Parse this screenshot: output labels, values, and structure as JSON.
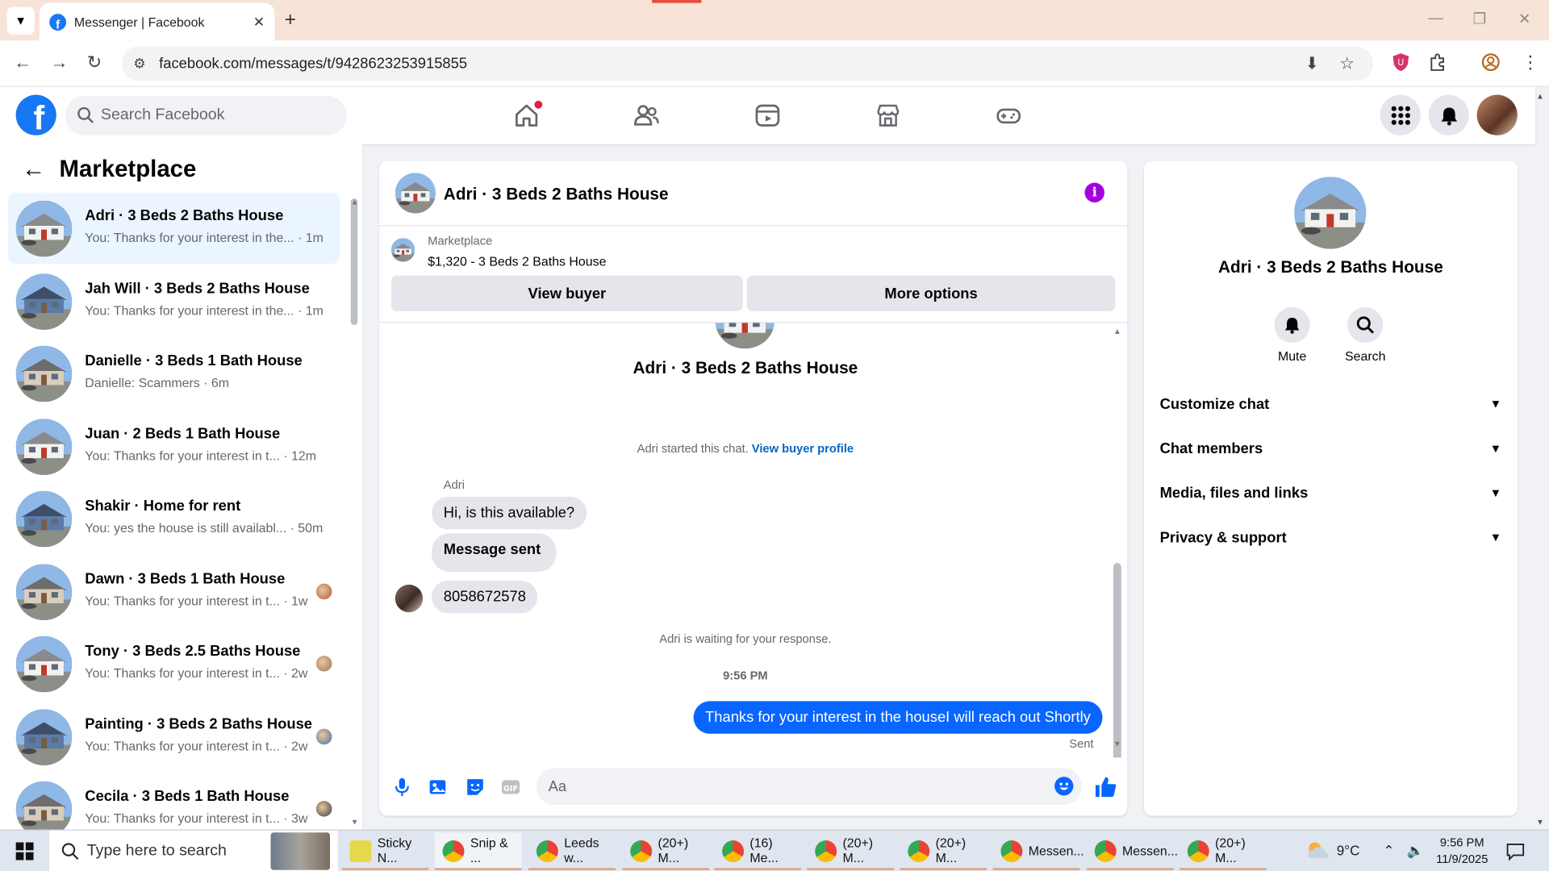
{
  "browser": {
    "tab_title": "Messenger | Facebook",
    "url": "facebook.com/messages/t/9428623253915855"
  },
  "header": {
    "search_placeholder": "Search Facebook"
  },
  "left": {
    "title": "Marketplace",
    "conversations": [
      {
        "title": "Adri · 3 Beds 2 Baths House",
        "preview": "You: Thanks for your interest in the...",
        "time": "1m",
        "active": true
      },
      {
        "title": "Jah Will · 3 Beds 2 Baths House",
        "preview": "You: Thanks for your interest in the...",
        "time": "1m"
      },
      {
        "title": "Danielle · 3 Beds 1 Bath House",
        "preview": "Danielle: Scammers",
        "time": "6m"
      },
      {
        "title": "Juan · 2 Beds 1 Bath House",
        "preview": "You: Thanks for your interest in t...",
        "time": "12m"
      },
      {
        "title": "Shakir · Home for rent",
        "preview": "You: yes the house is still availabl...",
        "time": "50m"
      },
      {
        "title": "Dawn · 3 Beds 1 Bath House",
        "preview": "You: Thanks for your interest in t...",
        "time": "1w"
      },
      {
        "title": "Tony · 3 Beds 2.5 Baths House",
        "preview": "You: Thanks for your interest in t...",
        "time": "2w"
      },
      {
        "title": "Painting · 3 Beds 2 Baths House",
        "preview": "You: Thanks for your interest in t...",
        "time": "2w"
      },
      {
        "title": "Cecila · 3 Beds 1 Bath House",
        "preview": "You: Thanks for your interest in t...",
        "time": "3w"
      }
    ]
  },
  "chat": {
    "title": "Adri · 3 Beds 2 Baths House",
    "marketplace_label": "Marketplace",
    "listing": "$1,320 - 3 Beds 2 Baths House",
    "view_buyer": "View buyer",
    "more_options": "More options",
    "center_title": "Adri · 3 Beds 2 Baths House",
    "started_text": "Adri started this chat.",
    "view_profile": "View buyer profile",
    "sender": "Adri",
    "incoming": [
      "Hi, is this available?",
      "Message sent",
      "8058672578"
    ],
    "waiting": "Adri is waiting for your response.",
    "time": "9:56 PM",
    "outgoing": "Thanks for your interest in the houseI will reach out Shortly",
    "sent_label": "Sent",
    "composer_placeholder": "Aa"
  },
  "right": {
    "title": "Adri · 3 Beds 2 Baths House",
    "mute": "Mute",
    "search": "Search",
    "sections": [
      "Customize chat",
      "Chat members",
      "Media, files and links",
      "Privacy & support"
    ]
  },
  "taskbar": {
    "search_placeholder": "Type here to search",
    "apps": [
      "Sticky N...",
      "Snip & ...",
      "Leeds w...",
      "(20+) M...",
      "(16) Me...",
      "(20+) M...",
      "(20+) M...",
      "Messen...",
      "Messen...",
      "(20+) M..."
    ],
    "weather": "9°C",
    "time": "9:56 PM",
    "date": "11/9/2025"
  },
  "colors": {
    "fb_blue": "#1877f2",
    "messenger_blue": "#0866ff",
    "info_purple": "#a400e1"
  }
}
